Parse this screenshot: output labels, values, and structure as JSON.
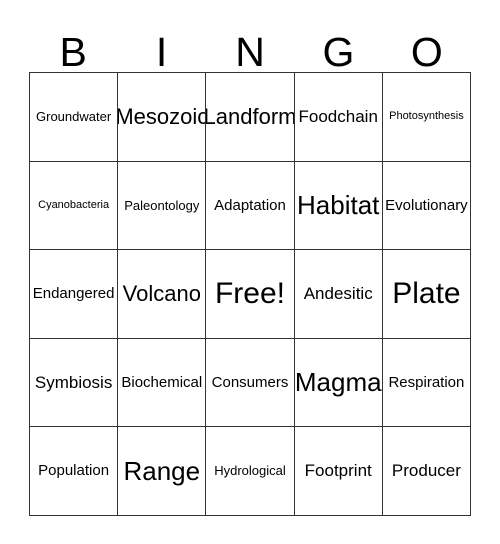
{
  "card": {
    "header_letters": [
      "B",
      "I",
      "N",
      "G",
      "O"
    ],
    "columns": [
      "B",
      "I",
      "N",
      "G",
      "O"
    ],
    "free_space_label": "Free!",
    "rows": [
      [
        {
          "label": "Groundwater",
          "size": "s"
        },
        {
          "label": "Mesozoic",
          "size": "xl"
        },
        {
          "label": "Landform",
          "size": "xl"
        },
        {
          "label": "Foodchain",
          "size": "l"
        },
        {
          "label": "Photosynthesis",
          "size": "xs"
        }
      ],
      [
        {
          "label": "Cyanobacteria",
          "size": "xs"
        },
        {
          "label": "Paleontology",
          "size": "s"
        },
        {
          "label": "Adaptation",
          "size": "m"
        },
        {
          "label": "Habitat",
          "size": "xxl"
        },
        {
          "label": "Evolutionary",
          "size": "m"
        }
      ],
      [
        {
          "label": "Endangered",
          "size": "m"
        },
        {
          "label": "Volcano",
          "size": "xl"
        },
        {
          "label": "Free!",
          "size": "huge"
        },
        {
          "label": "Andesitic",
          "size": "l"
        },
        {
          "label": "Plate",
          "size": "huge"
        }
      ],
      [
        {
          "label": "Symbiosis",
          "size": "l"
        },
        {
          "label": "Biochemical",
          "size": "m"
        },
        {
          "label": "Consumers",
          "size": "m"
        },
        {
          "label": "Magma",
          "size": "xxl"
        },
        {
          "label": "Respiration",
          "size": "m"
        }
      ],
      [
        {
          "label": "Population",
          "size": "m"
        },
        {
          "label": "Range",
          "size": "xxl"
        },
        {
          "label": "Hydrological",
          "size": "s"
        },
        {
          "label": "Footprint",
          "size": "l"
        },
        {
          "label": "Producer",
          "size": "l"
        }
      ]
    ]
  },
  "colors": {
    "background": "#ffffff",
    "text": "#000000",
    "grid_line": "#333333"
  }
}
